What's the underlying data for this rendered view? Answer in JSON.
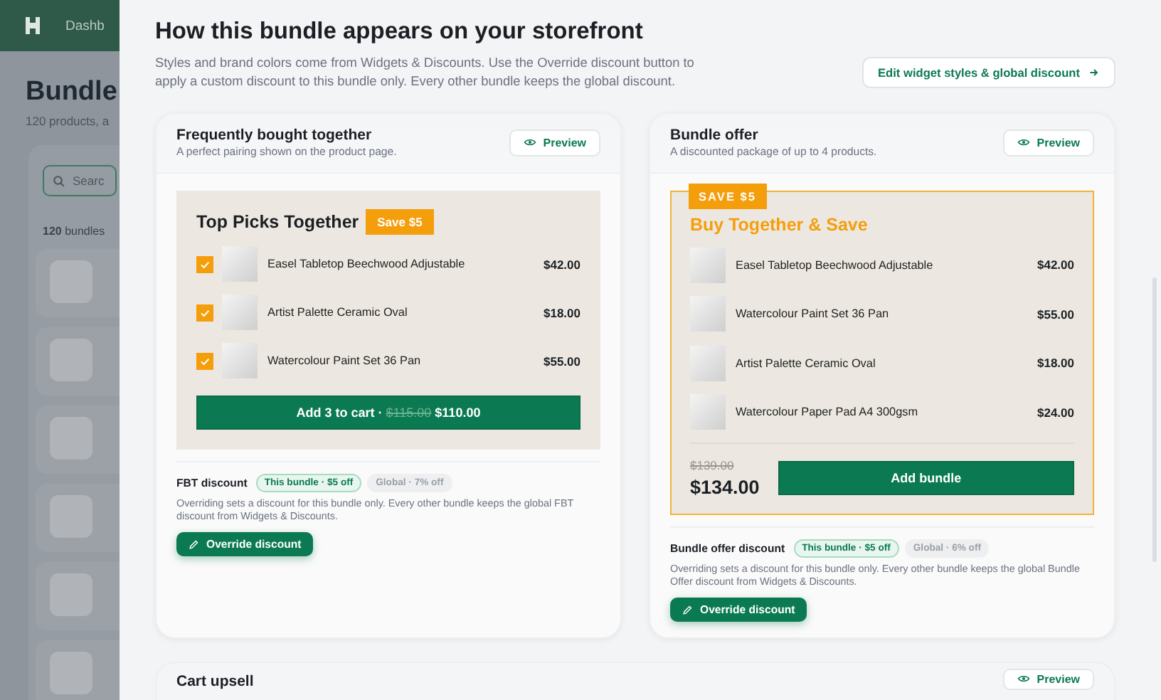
{
  "background_page": {
    "nav_item": "Dashb",
    "title": "Bundle",
    "subtitle": "120 products, a",
    "search_placeholder": "Searc",
    "count": "**120** bundles"
  },
  "drawer": {
    "title": "How this bundle appears on your storefront",
    "description": "Styles and brand colors come from Widgets & Discounts. Use the Override discount button to apply a custom discount to this bundle only. Every other bundle keeps the global discount.",
    "edit_button": "Edit widget styles & global discount"
  },
  "cards": [
    {
      "kind": "fbt",
      "title": "Frequently bought together",
      "subtitle": "A perfect pairing shown on the product page.",
      "preview_label": "Preview",
      "widget": {
        "heading": "Top Picks Together",
        "badge": "Save $5",
        "items": [
          {
            "name": "Easel Tabletop Beechwood Adjustable",
            "price": "$42.00",
            "checked": true
          },
          {
            "name": "Artist Palette Ceramic Oval",
            "price": "$18.00",
            "checked": true
          },
          {
            "name": "Watercolour Paint Set 36 Pan",
            "price": "$55.00",
            "checked": true
          }
        ],
        "button": {
          "label": "Add 3 to cart ·",
          "old_price": "$115.00",
          "new_price": "$110.00"
        }
      },
      "discount": {
        "label": "FBT discount",
        "chips": [
          {
            "label": "This bundle · $5 off",
            "selected": true
          },
          {
            "label": "Global · 7% off",
            "selected": false
          }
        ],
        "note": "Overriding sets a discount for this bundle only. Every other bundle keeps the global FBT discount from Widgets & Discounts.",
        "button": "Override discount"
      }
    },
    {
      "kind": "bundle_offer",
      "title": "Bundle offer",
      "subtitle": "A discounted package of up to 4 products.",
      "preview_label": "Preview",
      "widget": {
        "badge": "SAVE $5",
        "heading": "Buy Together & Save",
        "items": [
          {
            "name": "Easel Tabletop Beechwood Adjustable",
            "price": "$42.00"
          },
          {
            "name": "Watercolour Paint Set 36 Pan",
            "price": "$55.00"
          },
          {
            "name": "Artist Palette Ceramic Oval",
            "price": "$18.00"
          },
          {
            "name": "Watercolour Paper Pad A4 300gsm",
            "price": "$24.00"
          }
        ],
        "old_total": "$139.00",
        "total": "$134.00",
        "button": {
          "label": "Add bundle"
        }
      },
      "discount": {
        "label": "Bundle offer discount",
        "chips": [
          {
            "label": "This bundle · $5 off",
            "selected": true
          },
          {
            "label": "Global · 6% off",
            "selected": false
          }
        ],
        "note": "Overriding sets a discount for this bundle only. Every other bundle keeps the global Bundle Offer discount from Widgets & Discounts.",
        "button": "Override discount"
      }
    }
  ],
  "cart_upsell": {
    "title": "Cart upsell",
    "preview_label": "Preview"
  }
}
